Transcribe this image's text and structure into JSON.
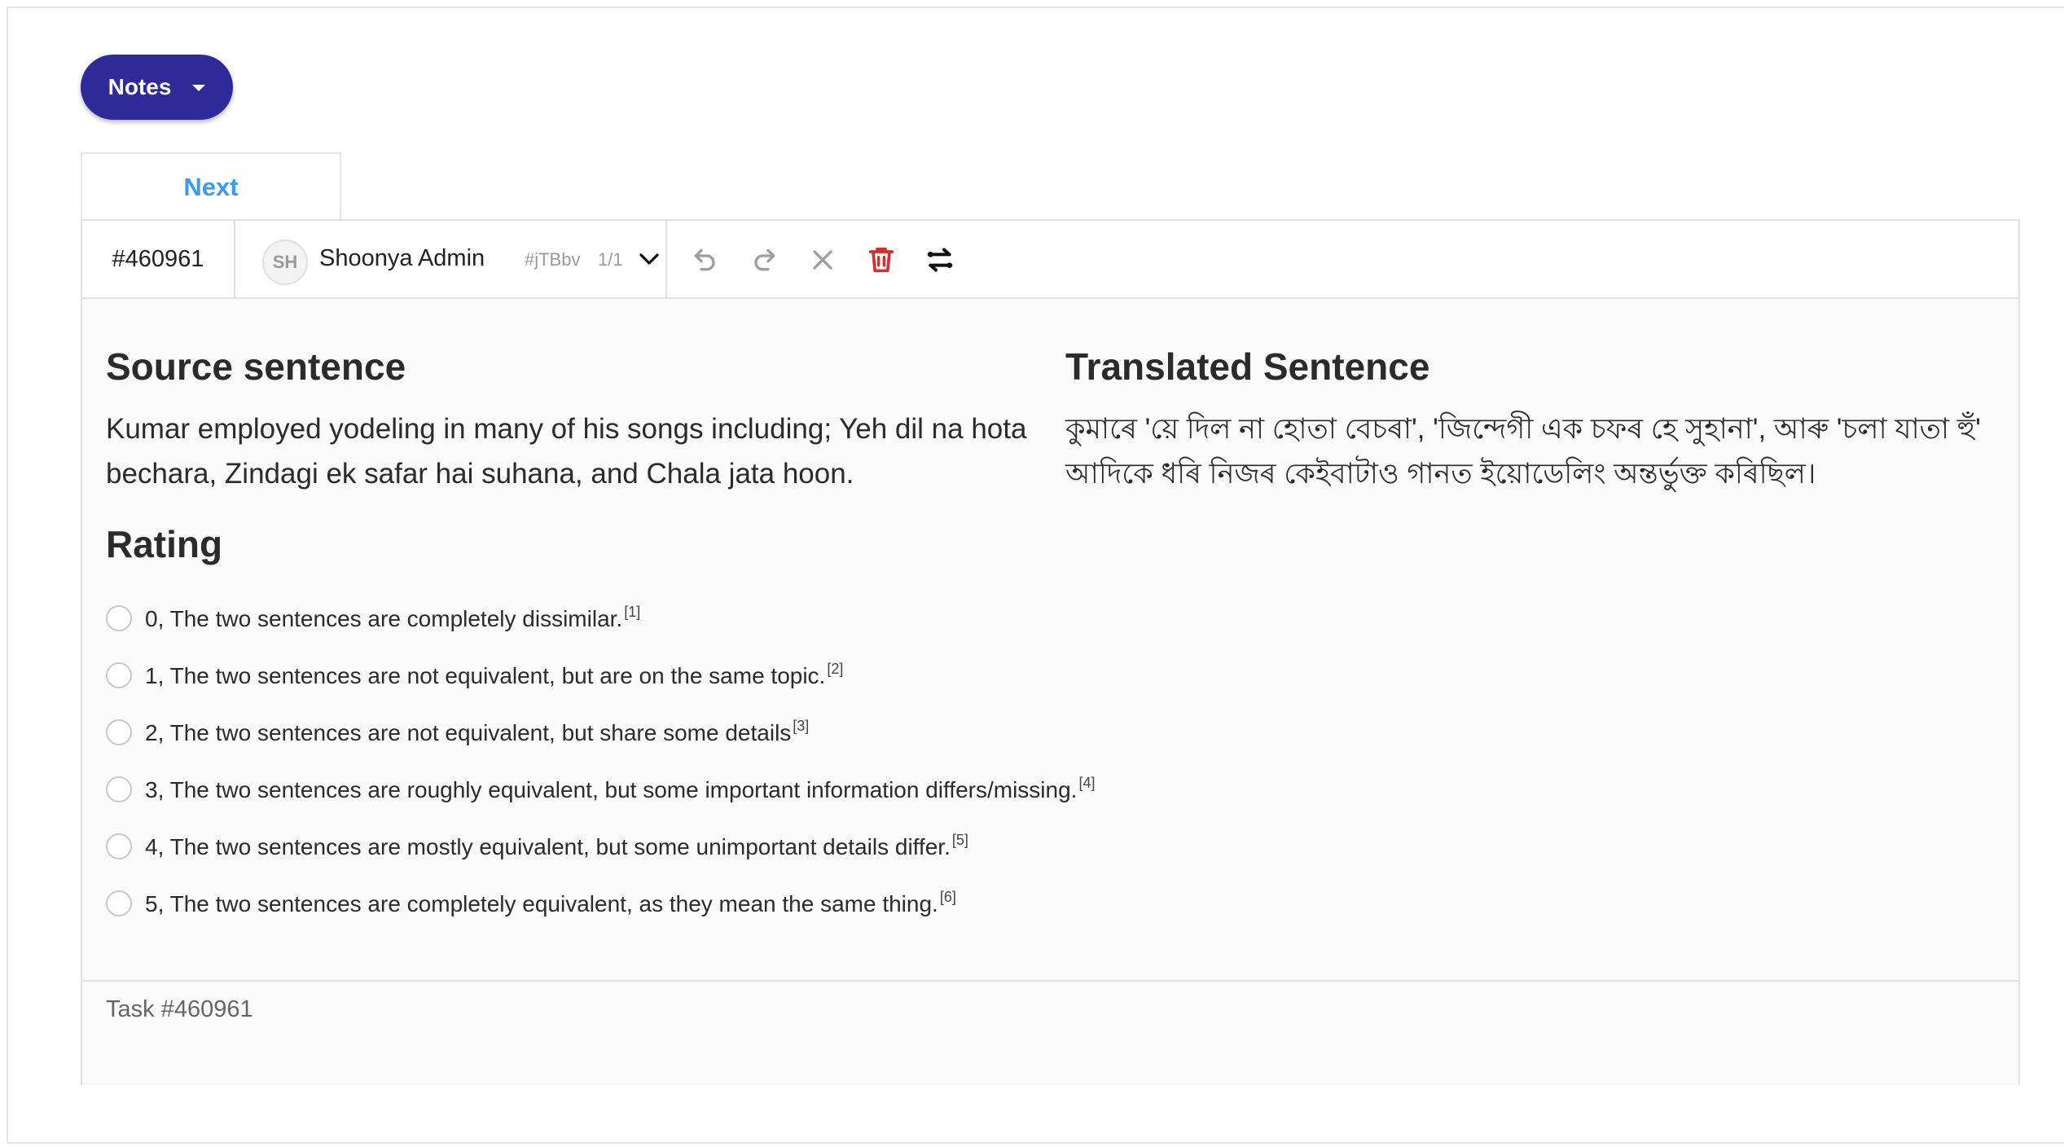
{
  "notes_button": {
    "label": "Notes"
  },
  "next_tab": {
    "label": "Next"
  },
  "toolbar": {
    "task_id": "#460961",
    "annotator": {
      "initials": "SH",
      "name": "Shoonya Admin",
      "hash": "#jTBbv",
      "count": "1/1"
    },
    "icons": [
      "undo-icon",
      "redo-icon",
      "clear-icon",
      "delete-icon",
      "swap-icon"
    ],
    "colors": {
      "delete": "#d32f2f",
      "disabled": "#9e9e9e",
      "active": "#222222"
    }
  },
  "source": {
    "title": "Source sentence",
    "text": "Kumar employed yodeling in many of his songs including; Yeh dil na hota bechara, Zindagi ek safar hai suhana, and Chala jata hoon."
  },
  "translation": {
    "title": "Translated Sentence",
    "text": "কুমাৰে 'য়ে দিল না হোতা বেচৰা', 'জিন্দেগী এক চফৰ হে সুহানা', আৰু 'চলা যাতা হুঁ' আদিকে ধৰি নিজৰ কেইবাটাও গানত ইয়োডেলিং অন্তৰ্ভুক্ত কৰিছিল।"
  },
  "rating": {
    "title": "Rating",
    "options": [
      {
        "label": "0, The two sentences are completely dissimilar.",
        "ref": "[1]"
      },
      {
        "label": "1, The two sentences are not equivalent, but are on the same topic.",
        "ref": "[2]"
      },
      {
        "label": "2, The two sentences are not equivalent, but share some details",
        "ref": "[3]"
      },
      {
        "label": "3, The two sentences are roughly equivalent, but some important information differs/missing.",
        "ref": "[4]"
      },
      {
        "label": "4, The two sentences are mostly equivalent, but some unimportant details differ.",
        "ref": "[5]"
      },
      {
        "label": "5, The two sentences are completely equivalent, as they mean the same thing.",
        "ref": "[6]"
      }
    ]
  },
  "footer": {
    "label": "Task #460961"
  },
  "accent": {
    "notes": "#2e2a97",
    "next": "#3d9be9"
  }
}
